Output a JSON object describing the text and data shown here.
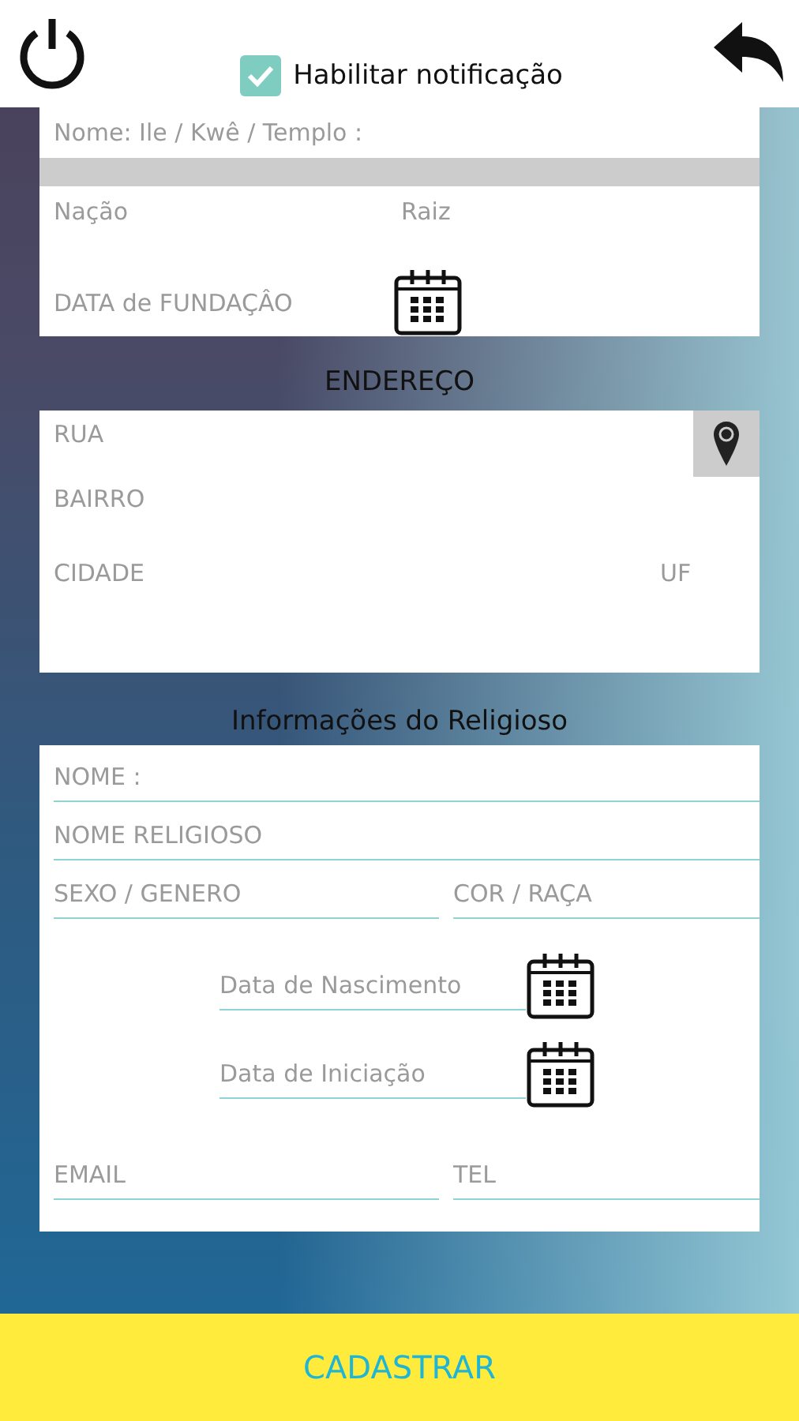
{
  "header": {
    "notification": {
      "label": "Habilitar notificação",
      "checked": true
    }
  },
  "establishment": {
    "name": {
      "placeholder": "Nome: Ile / Kwê / Templo :"
    },
    "nation": {
      "placeholder": "Nação"
    },
    "root": {
      "placeholder": "Raiz"
    },
    "foundation_date": {
      "placeholder": "DATA de FUNDAÇÂO"
    }
  },
  "address": {
    "title": "ENDEREÇO",
    "street": {
      "placeholder": "RUA"
    },
    "neighborhood": {
      "placeholder": "BAIRRO"
    },
    "city": {
      "placeholder": "CIDADE"
    },
    "state": {
      "placeholder": "UF"
    }
  },
  "religious": {
    "title": "Informações do Religioso",
    "name": {
      "placeholder": "NOME :"
    },
    "religious_name": {
      "placeholder": "NOME RELIGIOSO"
    },
    "gender": {
      "placeholder": "SEXO / GENERO"
    },
    "race": {
      "placeholder": "COR / RAÇA"
    },
    "birth_date": {
      "placeholder": "Data de Nascimento"
    },
    "initiation_date": {
      "placeholder": "Data de Iniciação"
    },
    "email": {
      "placeholder": "EMAIL"
    },
    "phone": {
      "placeholder": "TEL"
    }
  },
  "submit": "CADASTRAR"
}
